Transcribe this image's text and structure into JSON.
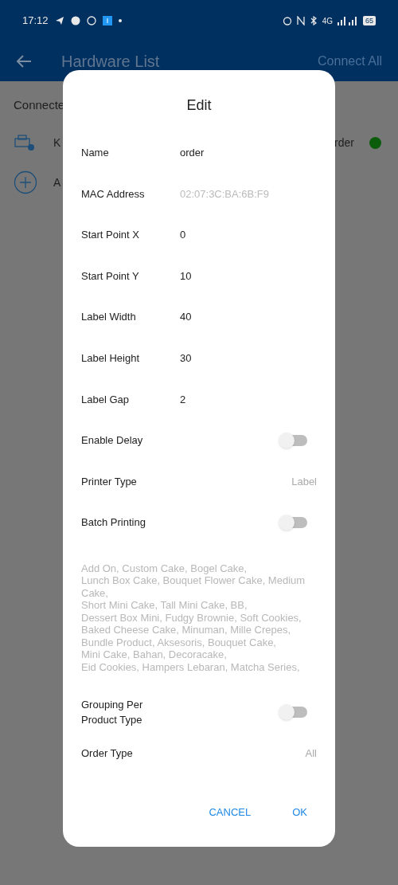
{
  "status_bar": {
    "time": "17:12",
    "network": "4G",
    "battery": "65"
  },
  "app_bar": {
    "title": "Hardware List",
    "action": "Connect All"
  },
  "background": {
    "section": "Connecte",
    "device_name": "K",
    "device_label": "rder",
    "device_connected": true,
    "add_label": "A"
  },
  "dialog": {
    "title": "Edit",
    "rows": [
      {
        "kind": "text",
        "label": "Name",
        "value": "order"
      },
      {
        "kind": "readonly",
        "label": "MAC Address",
        "value": "02:07:3C:BA:6B:F9"
      },
      {
        "kind": "text",
        "label": "Start Point X",
        "value": "0"
      },
      {
        "kind": "text",
        "label": "Start Point Y",
        "value": "10"
      },
      {
        "kind": "text",
        "label": "Label Width",
        "value": "40"
      },
      {
        "kind": "text",
        "label": "Label Height",
        "value": "30"
      },
      {
        "kind": "text",
        "label": "Label Gap",
        "value": "2"
      },
      {
        "kind": "toggle",
        "label": "Enable Delay",
        "on": false
      },
      {
        "kind": "select",
        "label": "Printer Type",
        "value": "Label"
      },
      {
        "kind": "toggle",
        "label": "Batch Printing",
        "on": false
      }
    ],
    "product_types": "Add On, Custom Cake, Bogel Cake,\nLunch Box Cake, Bouquet Flower Cake, Medium Cake,\nShort Mini Cake, Tall Mini Cake, BB,\nDessert Box Mini, Fudgy Brownie, Soft Cookies,\nBaked Cheese Cake, Minuman, Mille Crepes,\nBundle Product, Aksesoris, Bouquet Cake,\nMini Cake, Bahan, Decoracake,\nEid Cookies, Hampers Lebaran, Matcha Series,",
    "rows_after": [
      {
        "kind": "toggle",
        "label": "Grouping Per Product Type",
        "on": false
      },
      {
        "kind": "select",
        "label": "Order Type",
        "value": "All"
      }
    ],
    "buttons": [
      "CANCEL",
      "OK"
    ]
  }
}
